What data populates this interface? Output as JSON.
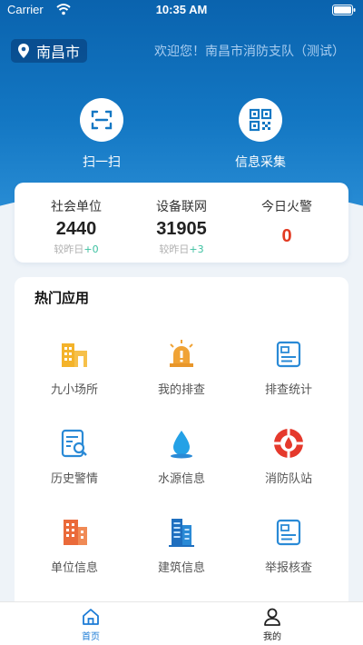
{
  "status": {
    "carrier": "Carrier",
    "time": "10:35 AM"
  },
  "header": {
    "city": "南昌市",
    "welcome": "欢迎您！南昌市消防支队（测试）"
  },
  "quick_actions": [
    {
      "label": "扫一扫",
      "icon": "scan-icon"
    },
    {
      "label": "信息采集",
      "icon": "qr-code-icon"
    }
  ],
  "stats": {
    "social_units": {
      "title": "社会单位",
      "value": "2440",
      "change_label": "较昨日",
      "change": "+0"
    },
    "devices": {
      "title": "设备联网",
      "value": "31905",
      "change_label": "较昨日",
      "change": "+3"
    },
    "fires": {
      "title": "今日火警",
      "value": "0"
    }
  },
  "apps": {
    "title": "热门应用",
    "items": [
      {
        "label": "九小场所",
        "icon": "buildings-icon"
      },
      {
        "label": "我的排查",
        "icon": "alarm-icon"
      },
      {
        "label": "排查统计",
        "icon": "statistics-card-icon"
      },
      {
        "label": "历史警情",
        "icon": "document-search-icon"
      },
      {
        "label": "水源信息",
        "icon": "water-drop-icon"
      },
      {
        "label": "消防队站",
        "icon": "fire-station-icon"
      },
      {
        "label": "单位信息",
        "icon": "office-building-icon"
      },
      {
        "label": "建筑信息",
        "icon": "tower-building-icon"
      },
      {
        "label": "举报核查",
        "icon": "report-card-icon"
      }
    ]
  },
  "tabbar": {
    "home": "首页",
    "mine": "我的"
  },
  "colors": {
    "primary": "#1377c3",
    "accent_blue": "#1b7bd6",
    "fire_red": "#e23a22",
    "delta_green": "#3bc0a0"
  }
}
